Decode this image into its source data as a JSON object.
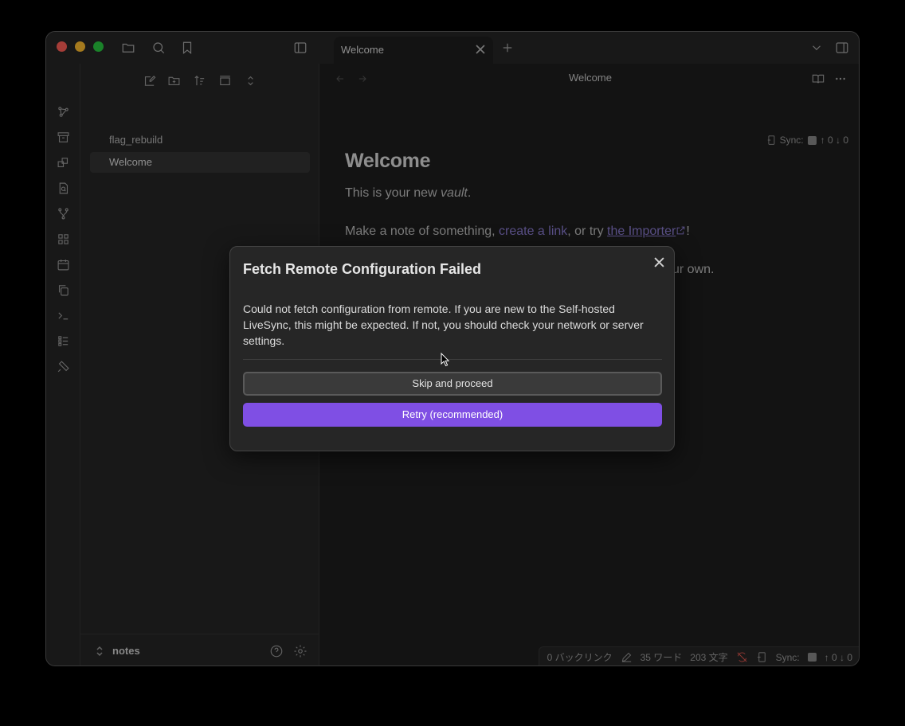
{
  "titlebar": {
    "tab_title": "Welcome"
  },
  "sidebar": {
    "files": [
      "flag_rebuild",
      "Welcome"
    ],
    "active_file": "Welcome",
    "vault_name": "notes"
  },
  "main": {
    "view_title": "Welcome",
    "sync_status": "Sync:",
    "sync_counts": "↑ 0 ↓ 0",
    "note": {
      "heading": "Welcome",
      "line1_prefix": "This is your new ",
      "line1_em": "vault",
      "line1_suffix": ".",
      "line2_prefix": "Make a note of something, ",
      "line2_link": "create a link",
      "line2_mid": ", or try ",
      "line2_ext": "the Importer",
      "line2_suffix": "!",
      "line3": "When you're ready, delete this note and make the vault your own."
    }
  },
  "statusbar": {
    "backlinks": "0 バックリンク",
    "words": "35 ワード",
    "chars": "203 文字",
    "sync_label": "Sync:",
    "sync_counts": "↑ 0 ↓ 0"
  },
  "modal": {
    "title": "Fetch Remote Configuration Failed",
    "body": "Could not fetch configuration from remote. If you are new to the Self-hosted LiveSync, this might be expected. If not, you should check your network or server settings.",
    "skip_label": "Skip and proceed",
    "retry_label": "Retry (recommended)"
  },
  "colors": {
    "accent": "#7f4fe4",
    "link": "#8a7bd1",
    "background": "#1e1e1e",
    "panel": "#262626"
  },
  "icons": {
    "titlebar": [
      "folder-icon",
      "search-icon",
      "bookmark-icon",
      "sidebar-toggle-icon",
      "plus-icon",
      "chevron-down-icon",
      "right-sidebar-icon"
    ],
    "ribbon": [
      "graph-icon",
      "archive-icon",
      "canvas-icon",
      "file-search-icon",
      "git-fork-icon",
      "grid-icon",
      "calendar-icon",
      "copy-icon",
      "terminal-icon",
      "list-icon",
      "plug-icon"
    ]
  }
}
